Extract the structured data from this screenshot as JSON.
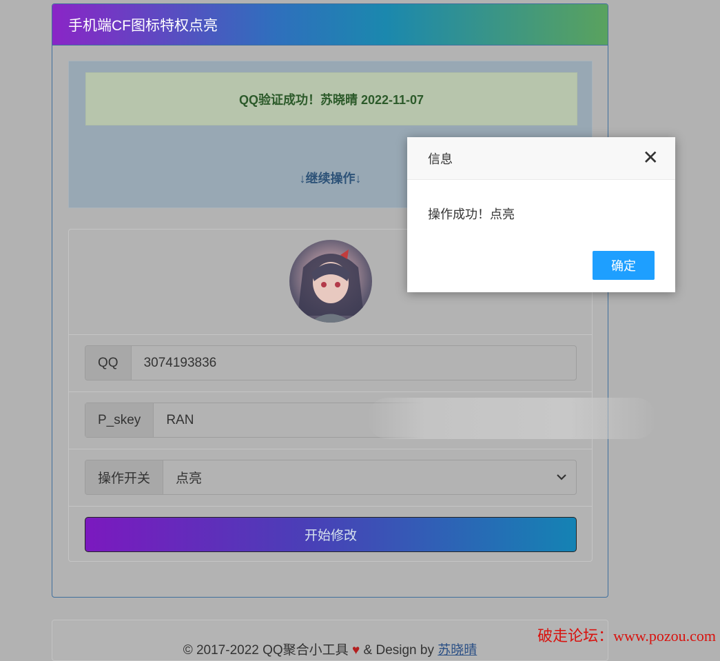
{
  "panel": {
    "title": "手机端CF图标特权点亮",
    "alert_message": "QQ验证成功！苏晓晴 2022-11-07",
    "continue_link": "↓继续操作↓"
  },
  "form": {
    "qq_label": "QQ",
    "qq_value": "3074193836",
    "pskey_label": "P_skey",
    "pskey_value": "RAN",
    "switch_label": "操作开关",
    "switch_selected": "点亮",
    "submit_label": "开始修改"
  },
  "footer": {
    "copyright": "© 2017-2022",
    "site": "QQ聚合小工具",
    "heart": "♥",
    "design_by": "& Design by",
    "author": "苏晓晴"
  },
  "watermark": "破走论坛：www.pozou.com",
  "dialog": {
    "title": "信息",
    "close_icon": "✕",
    "message": "操作成功！点亮",
    "ok_label": "确定"
  },
  "colors": {
    "dialog_ok": "#1e9fff",
    "alert_text": "#2c5a2a",
    "watermark": "#d8120e"
  }
}
